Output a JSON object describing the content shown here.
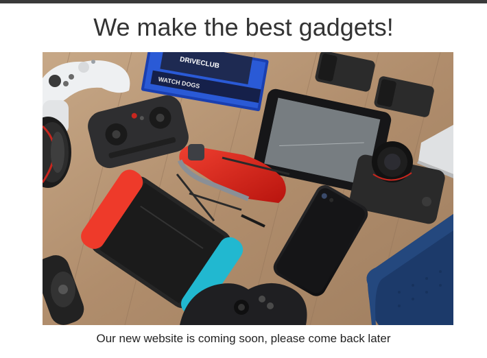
{
  "page": {
    "headline": "We make the best gadgets!",
    "tagline": "Our new website is coming soon, please come back later"
  },
  "hero_image": {
    "subject": "flat-lay of gadgets on a wooden table",
    "printed_text": {
      "game_case_brand": "DRIVECLUB",
      "game_case_title": "WATCH DOGS"
    }
  },
  "colors": {
    "text": "#333333",
    "top_bar": "#3a3a3a",
    "wood": "#b49373"
  }
}
